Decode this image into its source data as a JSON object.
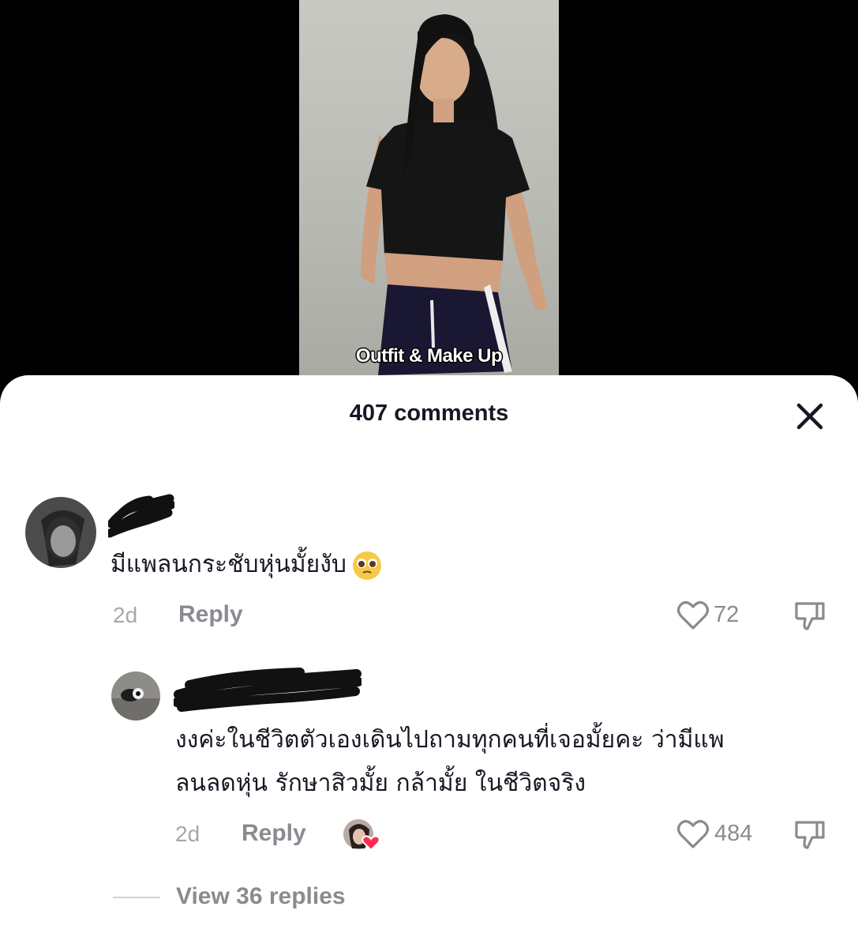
{
  "video": {
    "caption": "Outfit & Make Up"
  },
  "comments_sheet": {
    "title": "407 comments",
    "close_icon": "close-icon"
  },
  "comments": [
    {
      "text": "มีแพลนกระชับหุ่นมั้ยงับ",
      "emoji": "pleading-face",
      "time": "2d",
      "reply_label": "Reply",
      "likes": "72"
    },
    {
      "text_line1": "งงค่ะในชีวิตตัวเองเดินไปถามทุกคนที่เจอมั้ยคะ ว่ามีแพ",
      "text_line2": "ลนลดหุ่น รักษาสิวมั้ย กล้ามั้ย ในชีวิตจริง",
      "time": "2d",
      "reply_label": "Reply",
      "creator_liked_badge": "heart",
      "likes": "484"
    }
  ],
  "view_replies": "View 36 replies",
  "colors": {
    "text_primary": "#161823",
    "text_secondary": "#8a8b91",
    "creator_heart": "#fe2c55"
  }
}
